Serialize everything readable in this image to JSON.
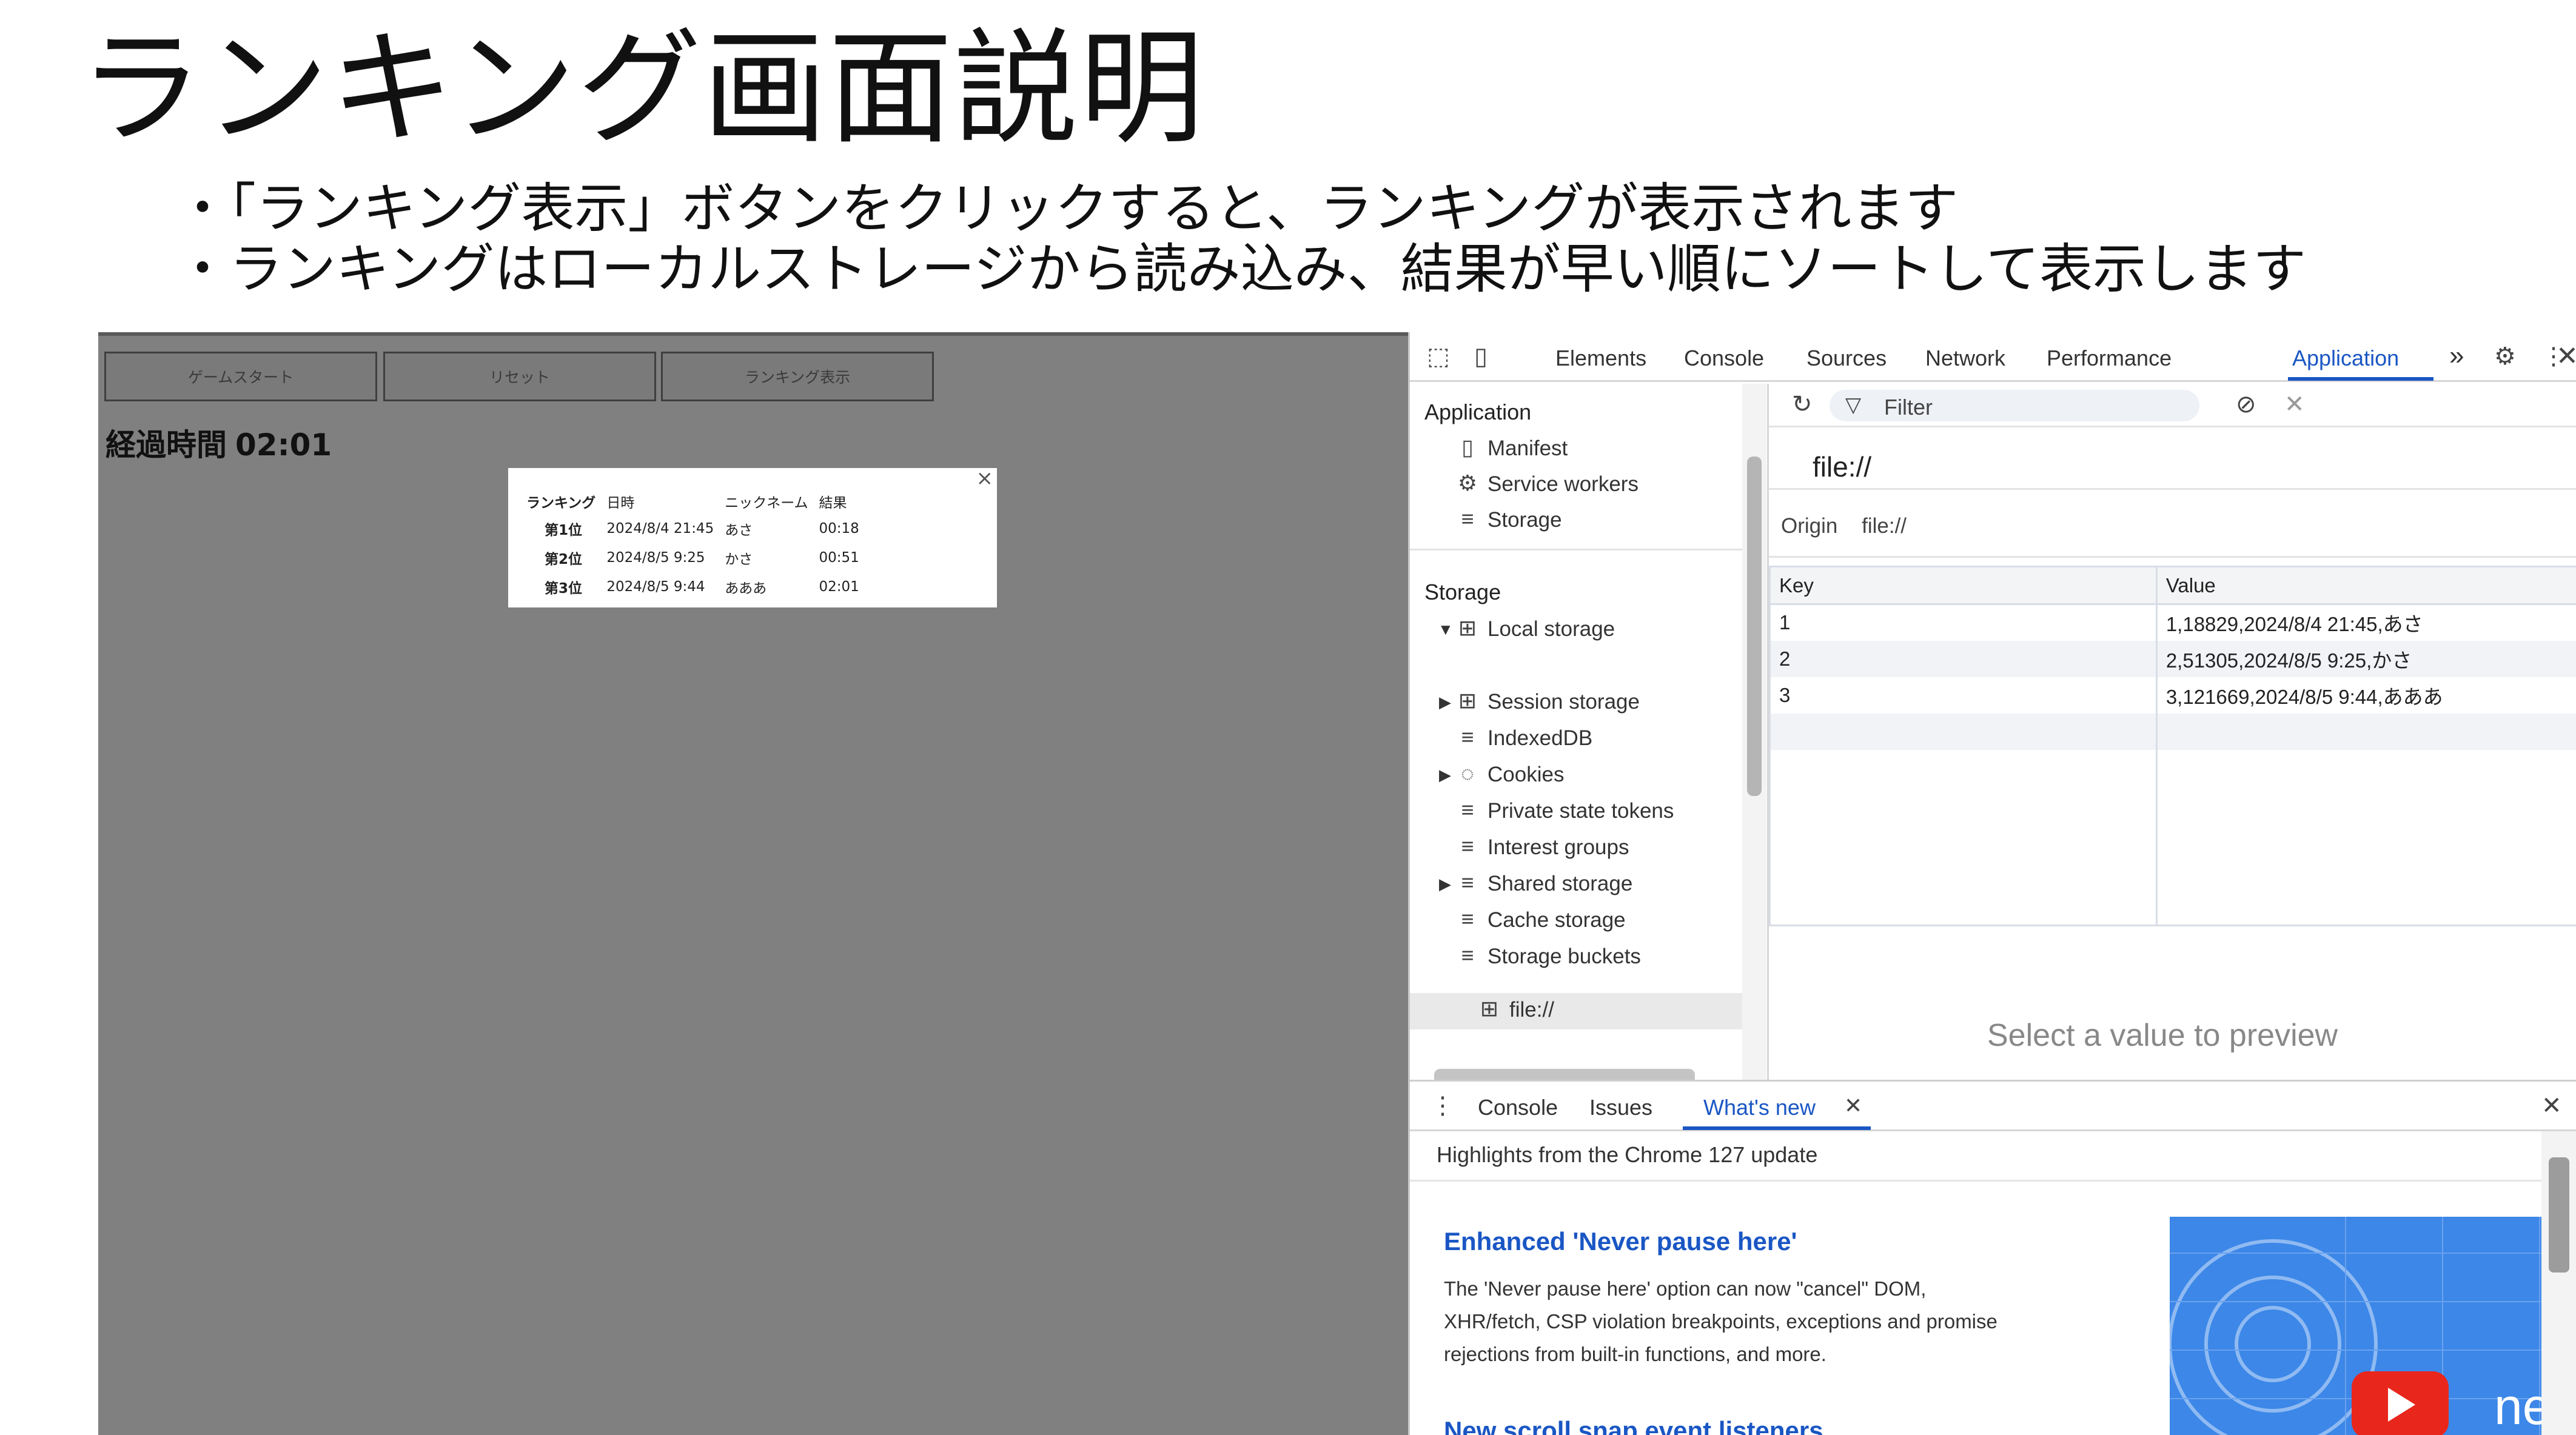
{
  "slide": {
    "title": "ランキング画面説明",
    "bullets": [
      "・「ランキング表示」ボタンをクリックすると、ランキングが表示されます",
      "・ランキングはローカルストレージから読み込み、結果が早い順にソートして表示します"
    ]
  },
  "page": {
    "buttons": {
      "start": "ゲームスタート",
      "reset": "リセット",
      "ranking": "ランキング表示"
    },
    "elapsed_label": "経過時間",
    "elapsed_value": "02:01",
    "ranking_popup": {
      "close": "×",
      "headers": [
        "ランキング",
        "日時",
        "ニックネーム",
        "結果"
      ],
      "rows": [
        {
          "place": "第1位",
          "datetime": "2024/8/4 21:45",
          "name": "あさ",
          "result": "00:18"
        },
        {
          "place": "第2位",
          "datetime": "2024/8/5 9:25",
          "name": "かさ",
          "result": "00:51"
        },
        {
          "place": "第3位",
          "datetime": "2024/8/5 9:44",
          "name": "あああ",
          "result": "02:01"
        }
      ]
    }
  },
  "devtools": {
    "tabs": [
      "Elements",
      "Console",
      "Sources",
      "Network",
      "Performance",
      "Application"
    ],
    "active_tab": "Application",
    "more_tabs": "»",
    "sidebar": {
      "application_header": "Application",
      "application_items": [
        "Manifest",
        "Service workers",
        "Storage"
      ],
      "storage_header": "Storage",
      "storage_items": [
        "Local storage",
        "file://",
        "Session storage",
        "IndexedDB",
        "Cookies",
        "Private state tokens",
        "Interest groups",
        "Shared storage",
        "Cache storage",
        "Storage buckets"
      ]
    },
    "filter_placeholder": "Filter",
    "origin_big": "file://",
    "origin_label": "Origin",
    "origin_value": "file://",
    "table": {
      "headers": [
        "Key",
        "Value"
      ],
      "rows": [
        {
          "key": "1",
          "value": "1,18829,2024/8/4 21:45,あさ"
        },
        {
          "key": "2",
          "value": "2,51305,2024/8/5 9:25,かさ"
        },
        {
          "key": "3",
          "value": "3,121669,2024/8/5 9:44,あああ"
        }
      ]
    },
    "preview_hint": "Select a value to preview",
    "drawer": {
      "tabs": [
        "Console",
        "Issues",
        "What's new"
      ],
      "active_tab": "What's new",
      "heading": "Highlights from the Chrome 127 update",
      "news": [
        {
          "title": "Enhanced 'Never pause here'",
          "body": "The 'Never pause here' option can now \"cancel\" DOM, XHR/fetch, CSP violation breakpoints, exceptions and promise rejections from built-in functions, and more."
        },
        {
          "title": "New scroll snap event listeners"
        }
      ],
      "video_label": "new"
    },
    "colors": {
      "accent": "#1a56c4",
      "page_bg": "#808080"
    }
  }
}
